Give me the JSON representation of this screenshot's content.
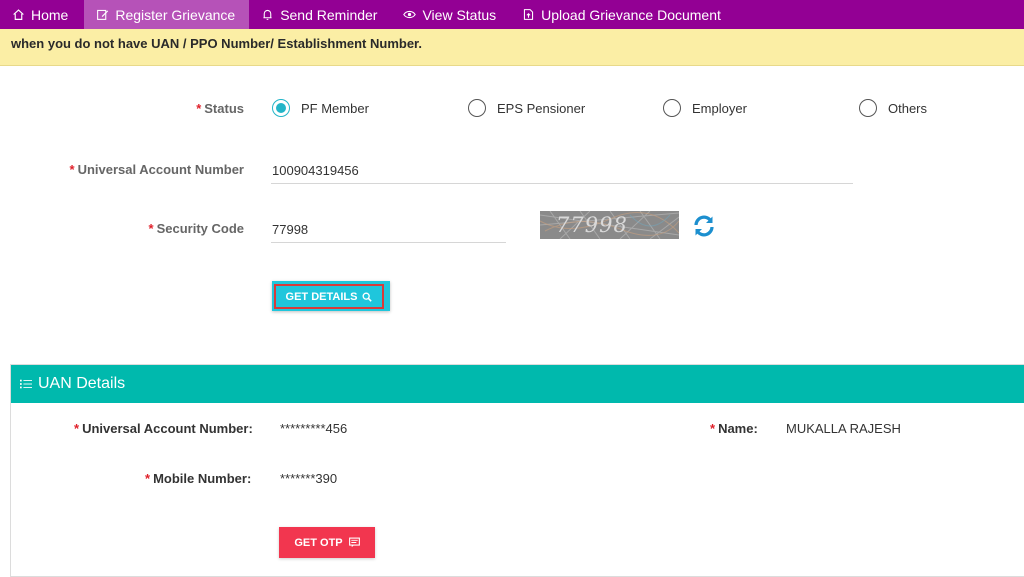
{
  "nav": {
    "items": [
      {
        "label": "Home",
        "icon": "home-icon",
        "active": false
      },
      {
        "label": "Register Grievance",
        "icon": "edit-icon",
        "active": true
      },
      {
        "label": "Send Reminder",
        "icon": "bell-icon",
        "active": false
      },
      {
        "label": "View Status",
        "icon": "eye-icon",
        "active": false
      },
      {
        "label": "Upload Grievance Document",
        "icon": "upload-document-icon",
        "active": false
      }
    ]
  },
  "notice": {
    "text": "when you do not have UAN / PPO Number/ Establishment Number."
  },
  "form": {
    "status_label": "Status",
    "status_options": [
      {
        "label": "PF Member",
        "selected": true
      },
      {
        "label": "EPS Pensioner",
        "selected": false
      },
      {
        "label": "Employer",
        "selected": false
      },
      {
        "label": "Others",
        "selected": false
      }
    ],
    "uan_label": "Universal Account Number",
    "uan_value": "100904319456",
    "security_label": "Security Code",
    "security_value": "77998",
    "captcha_text": "77998",
    "get_details_label": "GET DETAILS"
  },
  "uan_details": {
    "title": "UAN Details",
    "uan_label": "Universal Account Number:",
    "uan_value": "*********456",
    "name_label": "Name:",
    "name_value": "MUKALLA RAJESH",
    "mobile_label": "Mobile Number:",
    "mobile_value": "*******390",
    "get_otp_label": "GET OTP"
  },
  "colors": {
    "nav_bg": "#930094",
    "nav_active": "#b652b8",
    "notice_bg": "#fbeea5",
    "accent": "#23b5c8",
    "panel_head": "#00b9ad",
    "otp_button": "#f2364f",
    "required": "#e0202a"
  }
}
